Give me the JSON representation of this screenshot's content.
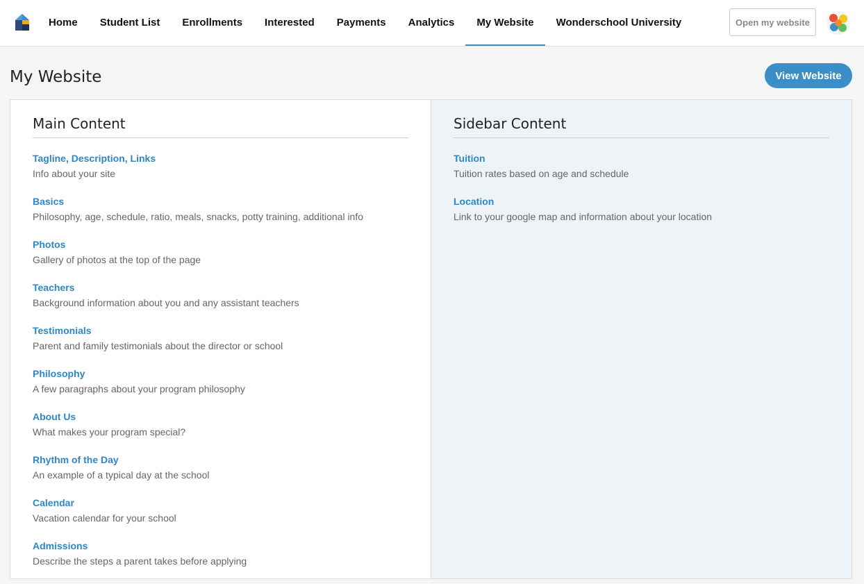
{
  "nav": {
    "items": [
      {
        "label": "Home",
        "name": "nav-home",
        "active": false
      },
      {
        "label": "Student List",
        "name": "nav-student-list",
        "active": false
      },
      {
        "label": "Enrollments",
        "name": "nav-enrollments",
        "active": false
      },
      {
        "label": "Interested",
        "name": "nav-interested",
        "active": false
      },
      {
        "label": "Payments",
        "name": "nav-payments",
        "active": false
      },
      {
        "label": "Analytics",
        "name": "nav-analytics",
        "active": false
      },
      {
        "label": "My Website",
        "name": "nav-my-website",
        "active": true
      },
      {
        "label": "Wonderschool University",
        "name": "nav-wonderschool-university",
        "active": false
      }
    ],
    "open_button": "Open my website",
    "accent_color": "#3b8fc7"
  },
  "page": {
    "title": "My Website",
    "view_button": "View Website"
  },
  "main_content": {
    "title": "Main Content",
    "items": [
      {
        "title": "Tagline, Description, Links",
        "description": "Info about your site"
      },
      {
        "title": "Basics",
        "description": "Philosophy, age, schedule, ratio, meals, snacks, potty training, additional info"
      },
      {
        "title": "Photos",
        "description": "Gallery of photos at the top of the page"
      },
      {
        "title": "Teachers",
        "description": "Background information about you and any assistant teachers"
      },
      {
        "title": "Testimonials",
        "description": "Parent and family testimonials about the director or school"
      },
      {
        "title": "Philosophy",
        "description": "A few paragraphs about your program philosophy"
      },
      {
        "title": "About Us",
        "description": "What makes your program special?"
      },
      {
        "title": "Rhythm of the Day",
        "description": "An example of a typical day at the school"
      },
      {
        "title": "Calendar",
        "description": "Vacation calendar for your school"
      },
      {
        "title": "Admissions",
        "description": "Describe the steps a parent takes before applying"
      }
    ]
  },
  "sidebar_content": {
    "title": "Sidebar Content",
    "items": [
      {
        "title": "Tuition",
        "description": "Tuition rates based on age and schedule"
      },
      {
        "title": "Location",
        "description": "Link to your google map and information about your location"
      }
    ]
  },
  "icons": {
    "logo": "wonderschool-house-logo",
    "avatar": "user-avatar"
  }
}
